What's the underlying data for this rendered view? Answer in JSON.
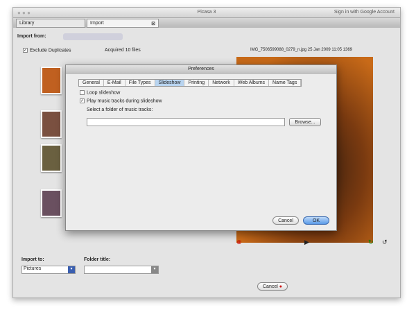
{
  "window": {
    "title": "Picasa 3",
    "sign_in": "Sign in with Google Account",
    "lights": "● ● ●"
  },
  "tabs": [
    {
      "label": "Library"
    },
    {
      "label": "Import"
    }
  ],
  "import_from": {
    "label": "Import from:"
  },
  "options": {
    "exclude_duplicates": "Exclude Duplicates",
    "acquired": "Acquired 10 files",
    "file_info": "IMG_7506599088_0279_n.jpg   25 Jan 2009 11:05   1369"
  },
  "prefs": {
    "title": "Preferences",
    "tabs": [
      {
        "label": "General"
      },
      {
        "label": "E-Mail"
      },
      {
        "label": "File Types"
      },
      {
        "label": "Slideshow"
      },
      {
        "label": "Printing"
      },
      {
        "label": "Network"
      },
      {
        "label": "Web Albums"
      },
      {
        "label": "Name Tags"
      }
    ],
    "loop": "Loop slideshow",
    "play_music": "Play music tracks during slideshow",
    "select_folder": "Select a folder of music tracks:",
    "folder_value": "",
    "browse": "Browse...",
    "cancel": "Cancel",
    "ok": "OK"
  },
  "bottom": {
    "import_to": "Import to:",
    "import_to_value": "Pictures",
    "folder_title": "Folder title:",
    "folder_title_value": "",
    "cancel": "Cancel"
  }
}
